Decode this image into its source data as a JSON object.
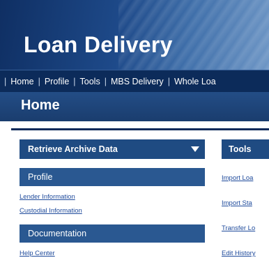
{
  "header": {
    "title": "Loan Delivery"
  },
  "nav": {
    "items": [
      "Home",
      "Profile",
      "Tools",
      "MBS Delivery",
      "Whole Loa"
    ]
  },
  "page": {
    "title": "Home"
  },
  "left_panel": {
    "dropdown_label": "Retrieve Archive Data",
    "profile": {
      "heading": "Profile",
      "links": [
        "Lender Information",
        "Custodial Information"
      ]
    },
    "documentation": {
      "heading": "Documentation",
      "links": [
        "Help Center"
      ]
    }
  },
  "tools_panel": {
    "heading": "Tools",
    "links": [
      "Import Loa",
      "Import Sta",
      "Transfer Lo",
      "Edit History"
    ]
  }
}
